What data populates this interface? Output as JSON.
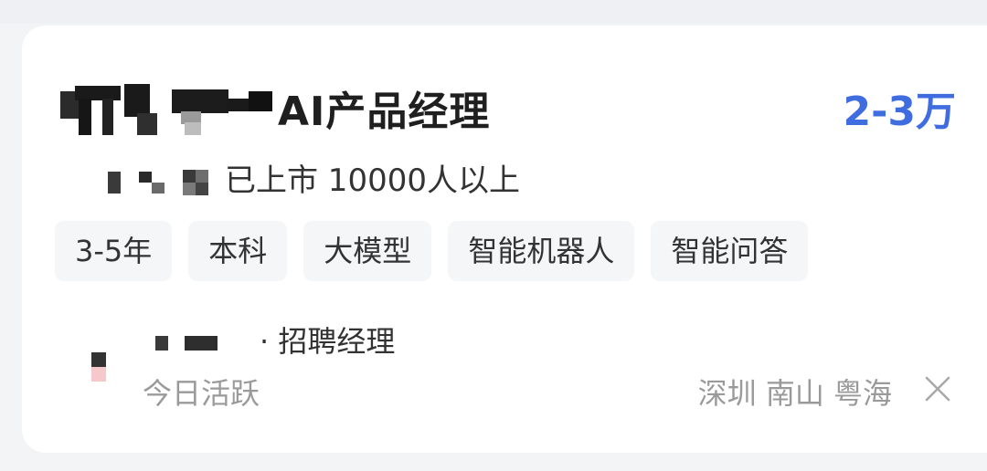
{
  "job": {
    "title": "AI产品经理",
    "salary": "2-3万"
  },
  "company": {
    "info": "已上市 10000人以上"
  },
  "tags": [
    "3-5年",
    "本科",
    "大模型",
    "智能机器人",
    "智能问答"
  ],
  "recruiter": {
    "title": "· 招聘经理",
    "status": "今日活跃"
  },
  "location": "深圳 南山 粤海",
  "icons": {
    "close": "close-icon"
  },
  "colors": {
    "accent": "#3f6de0",
    "text_primary": "#1f1f1f",
    "text_secondary": "#9a9a9a",
    "tag_bg": "#f5f6f8"
  }
}
